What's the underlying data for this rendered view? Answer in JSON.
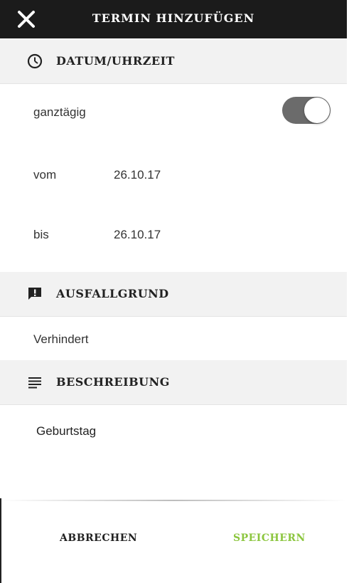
{
  "header": {
    "title": "TERMIN HINZUFÜGEN",
    "close_icon": "close-icon"
  },
  "datetime": {
    "section_title": "DATUM/UHRZEIT",
    "icon": "clock-icon",
    "allday_label": "ganztägig",
    "allday_enabled": true,
    "from_label": "vom",
    "from_value": "26.10.17",
    "to_label": "bis",
    "to_value": "26.10.17"
  },
  "reason": {
    "section_title": "AUSFALLGRUND",
    "icon": "alert-message-icon",
    "value": "Verhindert"
  },
  "description": {
    "section_title": "BESCHREIBUNG",
    "icon": "notes-icon",
    "value": "Geburtstag"
  },
  "footer": {
    "cancel_label": "ABBRECHEN",
    "save_label": "SPEICHERN"
  },
  "colors": {
    "topbar": "#1b1b1b",
    "section_bg": "#f2f2f2",
    "save_accent": "#8cc63f",
    "toggle_on": "#6b6b6b"
  }
}
